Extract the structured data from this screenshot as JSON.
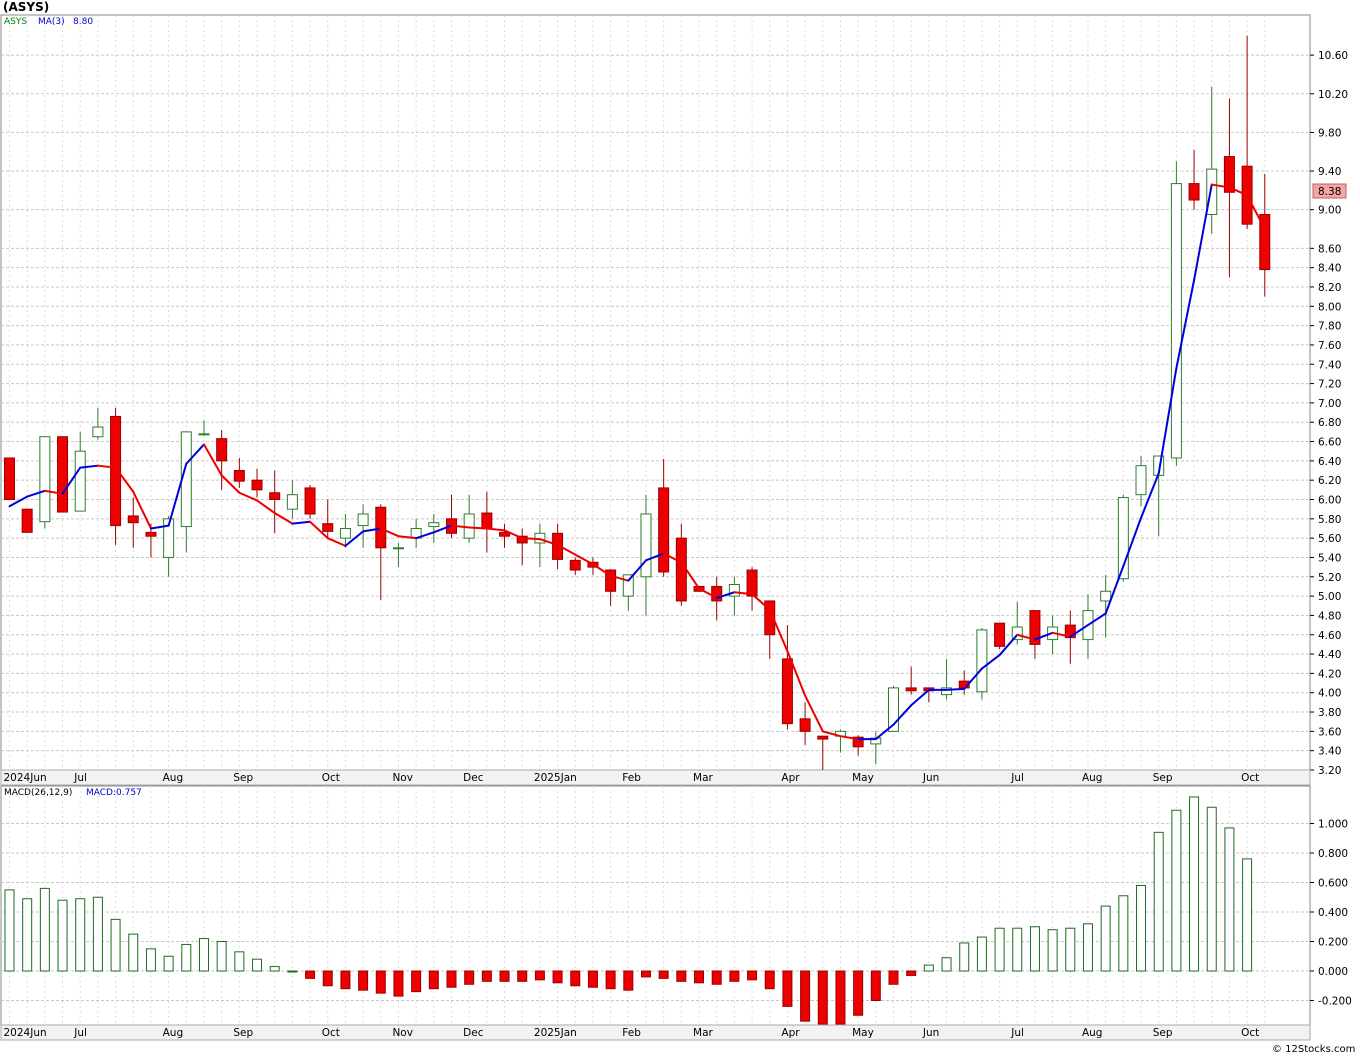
{
  "title": "(ASYS)",
  "credit": "© 12Stocks.com",
  "chart_data": [
    {
      "type": "candlestick",
      "symbol": "ASYS",
      "legend_symbol": "ASYS",
      "legend_ma": "MA(3)",
      "legend_ma_value": "8.80",
      "last_price_label": "8.38",
      "ylim": [
        3.2,
        10.86
      ],
      "y_ticks": [
        "3.20",
        "3.40",
        "3.60",
        "3.80",
        "4.00",
        "4.20",
        "4.40",
        "4.60",
        "4.80",
        "5.00",
        "5.20",
        "5.40",
        "5.60",
        "5.80",
        "6.00",
        "6.20",
        "6.40",
        "6.60",
        "6.80",
        "7.00",
        "7.20",
        "7.40",
        "7.60",
        "7.80",
        "8.00",
        "8.20",
        "8.40",
        "8.60",
        "9.00",
        "9.40",
        "9.80",
        "10.20",
        "10.60"
      ],
      "x_labels": [
        "2024Jun",
        "Jul",
        "Aug",
        "Sep",
        "Oct",
        "Nov",
        "Dec",
        "2025Jan",
        "Feb",
        "Mar",
        "Apr",
        "May",
        "Jun",
        "Jul",
        "Aug",
        "Sep",
        "Oct"
      ],
      "x_label_weeks": [
        0,
        4,
        9,
        13,
        18,
        22,
        26,
        30,
        35,
        39,
        44,
        48,
        52,
        57,
        61,
        65,
        70
      ],
      "grid": true,
      "candles": [
        {
          "o": 6.43,
          "h": 6.43,
          "l": 6.0,
          "c": 6.0
        },
        {
          "o": 5.9,
          "h": 5.9,
          "l": 5.66,
          "c": 5.66
        },
        {
          "o": 5.77,
          "h": 6.65,
          "l": 5.7,
          "c": 6.65
        },
        {
          "o": 6.65,
          "h": 6.65,
          "l": 5.87,
          "c": 5.87
        },
        {
          "o": 5.88,
          "h": 6.7,
          "l": 5.88,
          "c": 6.5
        },
        {
          "o": 6.65,
          "h": 6.95,
          "l": 6.62,
          "c": 6.75
        },
        {
          "o": 6.86,
          "h": 6.95,
          "l": 5.53,
          "c": 5.73
        },
        {
          "o": 5.83,
          "h": 6.02,
          "l": 5.5,
          "c": 5.76
        },
        {
          "o": 5.66,
          "h": 5.75,
          "l": 5.4,
          "c": 5.62
        },
        {
          "o": 5.4,
          "h": 5.83,
          "l": 5.2,
          "c": 5.8
        },
        {
          "o": 5.72,
          "h": 6.7,
          "l": 5.45,
          "c": 6.7
        },
        {
          "o": 6.68,
          "h": 6.82,
          "l": 6.66,
          "c": 6.68
        },
        {
          "o": 6.63,
          "h": 6.72,
          "l": 6.1,
          "c": 6.4
        },
        {
          "o": 6.3,
          "h": 6.43,
          "l": 6.12,
          "c": 6.19
        },
        {
          "o": 6.2,
          "h": 6.32,
          "l": 6.02,
          "c": 6.1
        },
        {
          "o": 6.07,
          "h": 6.3,
          "l": 5.65,
          "c": 6.0
        },
        {
          "o": 5.9,
          "h": 6.2,
          "l": 5.8,
          "c": 6.05
        },
        {
          "o": 6.12,
          "h": 6.15,
          "l": 5.8,
          "c": 5.85
        },
        {
          "o": 5.75,
          "h": 6.0,
          "l": 5.6,
          "c": 5.67
        },
        {
          "o": 5.6,
          "h": 5.85,
          "l": 5.5,
          "c": 5.7
        },
        {
          "o": 5.73,
          "h": 5.95,
          "l": 5.5,
          "c": 5.85
        },
        {
          "o": 5.92,
          "h": 5.95,
          "l": 4.96,
          "c": 5.5
        },
        {
          "o": 5.5,
          "h": 5.55,
          "l": 5.3,
          "c": 5.5
        },
        {
          "o": 5.6,
          "h": 5.8,
          "l": 5.5,
          "c": 5.7
        },
        {
          "o": 5.72,
          "h": 5.85,
          "l": 5.55,
          "c": 5.76
        },
        {
          "o": 5.8,
          "h": 6.05,
          "l": 5.6,
          "c": 5.65
        },
        {
          "o": 5.6,
          "h": 6.05,
          "l": 5.55,
          "c": 5.85
        },
        {
          "o": 5.86,
          "h": 6.08,
          "l": 5.45,
          "c": 5.7
        },
        {
          "o": 5.66,
          "h": 5.75,
          "l": 5.5,
          "c": 5.62
        },
        {
          "o": 5.62,
          "h": 5.7,
          "l": 5.32,
          "c": 5.55
        },
        {
          "o": 5.55,
          "h": 5.75,
          "l": 5.3,
          "c": 5.65
        },
        {
          "o": 5.65,
          "h": 5.75,
          "l": 5.28,
          "c": 5.38
        },
        {
          "o": 5.37,
          "h": 5.4,
          "l": 5.22,
          "c": 5.27
        },
        {
          "o": 5.35,
          "h": 5.4,
          "l": 5.22,
          "c": 5.3
        },
        {
          "o": 5.27,
          "h": 5.28,
          "l": 4.9,
          "c": 5.05
        },
        {
          "o": 5.0,
          "h": 5.2,
          "l": 4.85,
          "c": 5.22
        },
        {
          "o": 5.2,
          "h": 6.05,
          "l": 4.8,
          "c": 5.85
        },
        {
          "o": 6.12,
          "h": 6.42,
          "l": 5.2,
          "c": 5.25
        },
        {
          "o": 5.6,
          "h": 5.75,
          "l": 4.9,
          "c": 4.95
        },
        {
          "o": 5.1,
          "h": 5.1,
          "l": 5.05,
          "c": 5.05
        },
        {
          "o": 5.1,
          "h": 5.2,
          "l": 4.75,
          "c": 4.95
        },
        {
          "o": 5.0,
          "h": 5.2,
          "l": 4.8,
          "c": 5.12
        },
        {
          "o": 5.27,
          "h": 5.3,
          "l": 4.85,
          "c": 5.0
        },
        {
          "o": 4.95,
          "h": 4.95,
          "l": 4.35,
          "c": 4.6
        },
        {
          "o": 4.35,
          "h": 4.7,
          "l": 3.62,
          "c": 3.68
        },
        {
          "o": 3.73,
          "h": 3.9,
          "l": 3.46,
          "c": 3.6
        },
        {
          "o": 3.55,
          "h": 3.55,
          "l": 3.2,
          "c": 3.52
        },
        {
          "o": 3.55,
          "h": 3.62,
          "l": 3.38,
          "c": 3.6
        },
        {
          "o": 3.54,
          "h": 3.56,
          "l": 3.35,
          "c": 3.44
        },
        {
          "o": 3.47,
          "h": 3.6,
          "l": 3.26,
          "c": 3.53
        },
        {
          "o": 3.6,
          "h": 4.07,
          "l": 3.6,
          "c": 4.05
        },
        {
          "o": 4.05,
          "h": 4.27,
          "l": 3.98,
          "c": 4.02
        },
        {
          "o": 4.05,
          "h": 4.05,
          "l": 3.9,
          "c": 4.02
        },
        {
          "o": 3.98,
          "h": 4.35,
          "l": 3.93,
          "c": 4.05
        },
        {
          "o": 4.12,
          "h": 4.23,
          "l": 3.98,
          "c": 4.05
        },
        {
          "o": 4.01,
          "h": 4.67,
          "l": 3.93,
          "c": 4.65
        },
        {
          "o": 4.72,
          "h": 4.72,
          "l": 4.45,
          "c": 4.48
        },
        {
          "o": 4.55,
          "h": 4.94,
          "l": 4.5,
          "c": 4.68
        },
        {
          "o": 4.85,
          "h": 4.85,
          "l": 4.35,
          "c": 4.5
        },
        {
          "o": 4.55,
          "h": 4.8,
          "l": 4.4,
          "c": 4.68
        },
        {
          "o": 4.7,
          "h": 4.85,
          "l": 4.3,
          "c": 4.57
        },
        {
          "o": 4.55,
          "h": 5.02,
          "l": 4.35,
          "c": 4.85
        },
        {
          "o": 4.95,
          "h": 5.22,
          "l": 4.57,
          "c": 5.05
        },
        {
          "o": 5.18,
          "h": 6.05,
          "l": 5.15,
          "c": 6.02
        },
        {
          "o": 6.05,
          "h": 6.45,
          "l": 5.93,
          "c": 6.35
        },
        {
          "o": 6.25,
          "h": 6.45,
          "l": 5.62,
          "c": 6.45
        },
        {
          "o": 6.43,
          "h": 9.5,
          "l": 6.35,
          "c": 9.27
        },
        {
          "o": 9.27,
          "h": 9.62,
          "l": 9.0,
          "c": 9.1
        },
        {
          "o": 8.95,
          "h": 10.27,
          "l": 8.75,
          "c": 9.42
        },
        {
          "o": 9.55,
          "h": 10.15,
          "l": 8.3,
          "c": 9.18
        },
        {
          "o": 9.45,
          "h": 10.8,
          "l": 8.8,
          "c": 8.85
        },
        {
          "o": 8.95,
          "h": 9.37,
          "l": 8.1,
          "c": 8.38
        }
      ],
      "ma": [
        5.93,
        6.03,
        6.09,
        6.06,
        6.33,
        6.35,
        6.33,
        6.08,
        5.7,
        5.73,
        6.37,
        6.57,
        6.25,
        6.07,
        5.99,
        5.86,
        5.75,
        5.77,
        5.6,
        5.52,
        5.67,
        5.7,
        5.62,
        5.6,
        5.66,
        5.73,
        5.71,
        5.7,
        5.68,
        5.6,
        5.59,
        5.53,
        5.43,
        5.33,
        5.21,
        5.16,
        5.37,
        5.44,
        5.35,
        5.08,
        4.98,
        5.04,
        5.02,
        4.86,
        4.43,
        3.97,
        3.6,
        3.55,
        3.52,
        3.52,
        3.67,
        3.87,
        4.03,
        4.03,
        4.04,
        4.25,
        4.39,
        4.6,
        4.55,
        4.62,
        4.58,
        4.7,
        4.82,
        5.31,
        5.81,
        6.27,
        7.36,
        8.27,
        9.26,
        9.23,
        9.15,
        8.8
      ]
    },
    {
      "type": "bar",
      "title": "MACD(26,12,9)",
      "value_label": "MACD:0.757",
      "ylim": [
        -0.36,
        1.2
      ],
      "y_ticks": [
        "-0.200",
        "0.000",
        "0.200",
        "0.400",
        "0.600",
        "0.800",
        "1.000"
      ],
      "x_labels": [
        "2024Jun",
        "Jul",
        "Aug",
        "Sep",
        "Oct",
        "Nov",
        "Dec",
        "2025Jan",
        "Feb",
        "Mar",
        "Apr",
        "May",
        "Jun",
        "Jul",
        "Aug",
        "Sep",
        "Oct"
      ],
      "values": [
        0.55,
        0.49,
        0.56,
        0.48,
        0.49,
        0.5,
        0.35,
        0.25,
        0.15,
        0.1,
        0.18,
        0.22,
        0.2,
        0.13,
        0.08,
        0.03,
        0.0,
        -0.05,
        -0.1,
        -0.12,
        -0.13,
        -0.15,
        -0.17,
        -0.14,
        -0.12,
        -0.11,
        -0.09,
        -0.07,
        -0.07,
        -0.07,
        -0.06,
        -0.08,
        -0.1,
        -0.11,
        -0.12,
        -0.13,
        -0.04,
        -0.05,
        -0.07,
        -0.08,
        -0.09,
        -0.07,
        -0.06,
        -0.12,
        -0.24,
        -0.34,
        -0.38,
        -0.36,
        -0.3,
        -0.2,
        -0.09,
        -0.03,
        0.04,
        0.09,
        0.19,
        0.23,
        0.29,
        0.29,
        0.3,
        0.28,
        0.29,
        0.32,
        0.44,
        0.51,
        0.58,
        0.94,
        1.09,
        1.18,
        1.11,
        0.97,
        0.76
      ]
    }
  ]
}
